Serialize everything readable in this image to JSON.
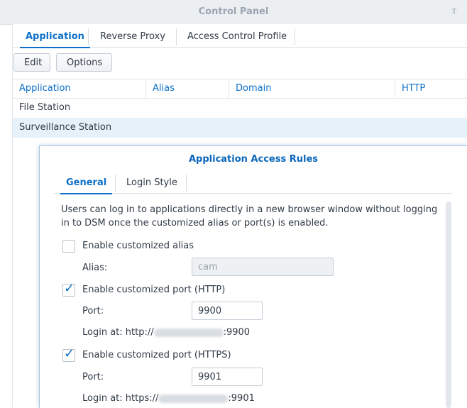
{
  "window": {
    "title": "Control Panel"
  },
  "tabs": [
    {
      "label": "Application",
      "active": true
    },
    {
      "label": "Reverse Proxy",
      "active": false
    },
    {
      "label": "Access Control Profile",
      "active": false
    }
  ],
  "toolbar": {
    "edit_label": "Edit",
    "options_label": "Options"
  },
  "table": {
    "columns": [
      "Application",
      "Alias",
      "Domain",
      "HTTP"
    ],
    "rows": [
      {
        "application": "File Station",
        "selected": false
      },
      {
        "application": "Surveillance Station",
        "selected": true
      }
    ]
  },
  "dialog": {
    "title": "Application Access Rules",
    "tabs": [
      {
        "label": "General",
        "active": true
      },
      {
        "label": "Login Style",
        "active": false
      }
    ],
    "description": "Users can log in to applications directly in a new browser window without logging in to DSM once the customized alias or port(s) is enabled.",
    "alias_section": {
      "checkbox_label": "Enable customized alias",
      "checked": false,
      "field_label": "Alias:",
      "value": "cam"
    },
    "http_section": {
      "checkbox_label": "Enable customized port (HTTP)",
      "checked": true,
      "field_label": "Port:",
      "value": "9900",
      "login_prefix": "Login at: http://",
      "login_suffix": ":9900"
    },
    "https_section": {
      "checkbox_label": "Enable customized port (HTTPS)",
      "checked": true,
      "field_label": "Port:",
      "value": "9901",
      "login_prefix": "Login at: https://",
      "login_suffix": ":9901"
    }
  },
  "colors": {
    "accent": "#0c70c9",
    "selected_row": "#e6f1fa"
  },
  "icons": {
    "pin": "pin-icon",
    "check": "checkmark-icon"
  }
}
